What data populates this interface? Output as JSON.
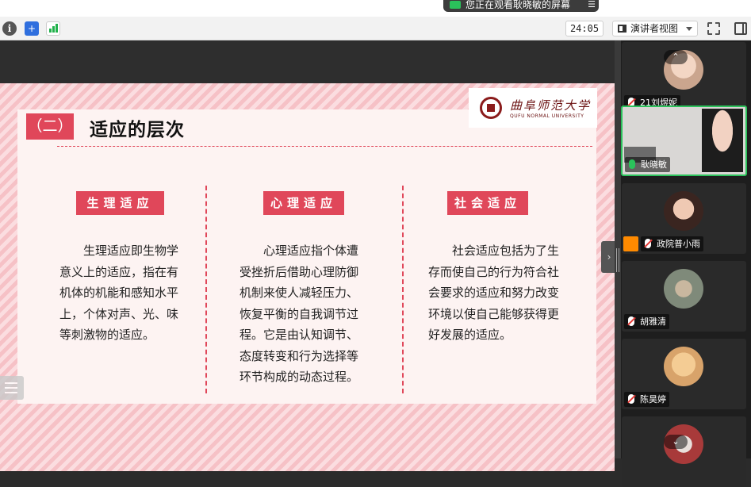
{
  "share_banner": {
    "text": "您正在观看耿晓敏的屏幕",
    "more": "☰"
  },
  "toolbar": {
    "info_glyph": "i",
    "shield_glyph": "+",
    "timer": "24:05",
    "view_label": "演讲者视图"
  },
  "slide": {
    "heading_number": "（二）",
    "heading_title": "适应的层次",
    "logo_cn": "曲阜师范大学",
    "logo_en": "QUFU NORMAL UNIVERSITY",
    "columns": [
      {
        "title": "生理适应",
        "body": "　　生理适应即生物学\n意义上的适应，指在有\n机体的机能和感知水平\n上，个体对声、光、味\n等刺激物的适应。"
      },
      {
        "title": "心理适应",
        "body": "　　心理适应指个体遭\n受挫折后借助心理防御\n机制来使人减轻压力、\n恢复平衡的自我调节过\n程。它是由认知调节、\n态度转变和行为选择等\n环节构成的动态过程。"
      },
      {
        "title": "社会适应",
        "body": "　　社会适应包括为了生\n存而使自己的行为符合社\n会要求的适应和努力改变\n环境以使自己能够获得更\n好发展的适应。"
      }
    ]
  },
  "participants": [
    {
      "name": "21刘煜妮",
      "mic": "muted",
      "host": false
    },
    {
      "name": "耿晓敏",
      "mic": "live",
      "host": false,
      "active": true
    },
    {
      "name": "政院普小雨",
      "mic": "muted",
      "host": true
    },
    {
      "name": "胡雅清",
      "mic": "muted",
      "host": false
    },
    {
      "name": "陈昊婷",
      "mic": "muted",
      "host": false
    }
  ],
  "colors": {
    "accent": "#e0475a",
    "active_border": "#2bc25b",
    "slide_bg": "#fdf3f2"
  }
}
